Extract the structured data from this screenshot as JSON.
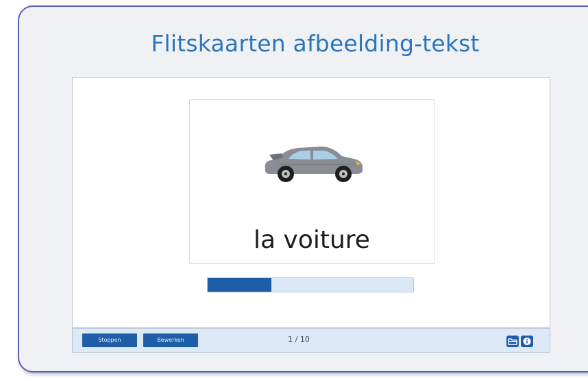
{
  "title": "Flitskaarten afbeelding-tekst",
  "card": {
    "image_icon": "car-icon",
    "word": "la voiture"
  },
  "progress": {
    "fraction": 0.31
  },
  "toolbar": {
    "stop_label": "Stoppen",
    "edit_label": "Bewerken",
    "counter": "1 / 10",
    "folder_icon": "folder-icon",
    "info_icon": "info-icon"
  },
  "colors": {
    "accent": "#1e5da8",
    "title": "#2a76bd",
    "frame_border": "#5b5fb8"
  }
}
